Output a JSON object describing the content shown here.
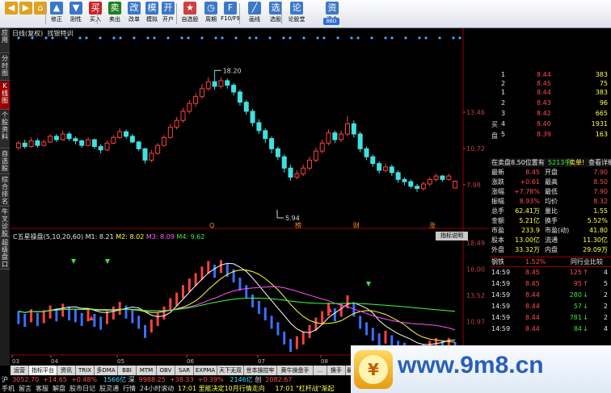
{
  "toolbar": {
    "buttons": [
      {
        "label": "",
        "icon": "back-icon",
        "color": "#e0a020"
      },
      {
        "label": "",
        "icon": "forward-icon",
        "color": "#e0a020"
      },
      {
        "label": "",
        "icon": "home-icon",
        "color": "#e0a020"
      },
      {
        "label": "修正",
        "icon": "up-icon",
        "color": "#3c78c8"
      },
      {
        "label": "刚性",
        "icon": "down-icon",
        "color": "#3c78c8"
      },
      {
        "label": "买入",
        "icon": "buy-icon",
        "color": "#d02020"
      },
      {
        "label": "卖出",
        "icon": "sell-icon",
        "color": "#208020"
      },
      {
        "label": "改单",
        "icon": "edit-icon",
        "color": "#3c78c8"
      },
      {
        "label": "模拟",
        "icon": "simulate-icon",
        "color": "#3c78c8"
      },
      {
        "label": "开户",
        "icon": "account-icon",
        "color": "#3c78c8"
      },
      {
        "label": "自选股",
        "icon": "favorites-icon",
        "color": "#d04040"
      },
      {
        "label": "周期",
        "icon": "period-icon",
        "color": "#3c78c8"
      },
      {
        "label": "F10/F9",
        "icon": "f10-icon",
        "color": "#3c78c8"
      },
      {
        "label": "画线",
        "icon": "draw-icon",
        "color": "#3c78c8"
      },
      {
        "label": "选股",
        "icon": "select-stock-icon",
        "color": "#3c78c8"
      },
      {
        "label": "论股堂",
        "icon": "forum-icon",
        "color": "#3c78c8"
      },
      {
        "label": "资金",
        "icon": "fund-icon",
        "color": "#3c78c8"
      }
    ],
    "bbd": "BBD"
  },
  "sidebar": [
    "应用",
    "分时图",
    "K线图",
    "个股资料",
    "自选股",
    "综合排名",
    "牛叉诊股",
    "超级盘口"
  ],
  "chart_header": {
    "title": "日线(复权)",
    "subtitle": "找银特训"
  },
  "price_axis": [
    "13.46",
    "10.72",
    "7.98"
  ],
  "price_markers": {
    "high": "18.20",
    "low": "5.94"
  },
  "event_markers": [
    "Q",
    "榜",
    "财",
    "涨"
  ],
  "indicator": {
    "name": "C五星操盘(5,10,20,60)",
    "m1": "M1: 8.21",
    "m2": "M2: 8.02",
    "m3": "M3: 8.09",
    "m4": "M4: 9.62",
    "help": "指标说明",
    "axis": [
      "18.49",
      "16.00",
      "13.52",
      "10.97",
      "8.49"
    ]
  },
  "date_axis": [
    "03",
    "04",
    "05",
    "06",
    "07",
    "08"
  ],
  "order_book": {
    "sells": [
      {
        "level": "1",
        "price": "8.44",
        "vol": "383"
      },
      {
        "level": "2",
        "price": "8.45",
        "vol": "75"
      }
    ],
    "side_label": "买盘",
    "buys": [
      {
        "level": "1",
        "price": "8.44",
        "vol": "383"
      },
      {
        "level": "2",
        "price": "8.43",
        "vol": "96"
      },
      {
        "level": "3",
        "price": "8.42",
        "vol": "665"
      },
      {
        "level": "4",
        "price": "8.40",
        "vol": "1931"
      },
      {
        "level": "5",
        "price": "8.39",
        "vol": "163"
      }
    ],
    "notice": "在卖盘8.50位置有",
    "notice_vol": "5213手",
    "notice_tag": "卖单!",
    "notice_link": "查看详细"
  },
  "quote": [
    {
      "l": "最新",
      "v": "8.45",
      "l2": "开盘",
      "v2": "7.90"
    },
    {
      "l": "涨跌",
      "v": "+0.61",
      "l2": "最高",
      "v2": "8.50"
    },
    {
      "l": "涨幅",
      "v": "+7.78%",
      "l2": "最低",
      "v2": "7.90"
    },
    {
      "l": "振幅",
      "v": "8.93%",
      "l2": "均价",
      "v2": "8.32"
    },
    {
      "l": "总手",
      "v": "62.41万",
      "l2": "量比",
      "v2": "1.55"
    },
    {
      "l": "金额",
      "v": "5.21亿",
      "l2": "换手",
      "v2": "5.52%"
    },
    {
      "l": "市盈",
      "v": "233.9",
      "l2": "市盈(动)",
      "v2": "41.80"
    },
    {
      "l": "股本",
      "v": "13.00亿",
      "l2": "流通",
      "v2": "11.30亿"
    },
    {
      "l": "外盘",
      "v": "33.32万",
      "l2": "内盘",
      "v2": "29.09万"
    }
  ],
  "industry": {
    "name": "钢铁",
    "pct": "1.52%",
    "link": "同行业比较"
  },
  "ticks": [
    {
      "t": "14:59",
      "p": "8.45",
      "v": "125",
      "d": "4"
    },
    {
      "t": "14:59",
      "p": "8.45",
      "v": "95",
      "d": "5"
    },
    {
      "t": "14:59",
      "p": "8.44",
      "v": "280",
      "d": "2"
    },
    {
      "t": "14:59",
      "p": "8.44",
      "v": "57",
      "d": "2"
    },
    {
      "t": "14:59",
      "p": "8.44",
      "v": "781",
      "d": "2"
    },
    {
      "t": "14:59",
      "p": "8.44",
      "v": "84",
      "d": "4"
    }
  ],
  "tabs": [
    "运营",
    "指标平台",
    "资讯",
    "TRIX",
    "多DMA",
    "BBI",
    "MTM",
    "OBV",
    "SAR",
    "EXPMA",
    "天下无双",
    "世本操控牢笼",
    "黄牛操盘手",
    "...",
    "换手",
    "最牛精选"
  ],
  "status_bar": {
    "sh_label": "沪",
    "sh_index": "3052.70",
    "sh_chg": "+14.65",
    "sh_pct": "+0.48%",
    "sh_amt": "1566亿",
    "sz_label": "深",
    "sz_index": "9988.25",
    "sz_chg": "+38.33",
    "sz_pct": "+0.39%",
    "sz_amt": "2146亿",
    "cy_label": "创",
    "cy_index": "2082.67",
    "menu": [
      "手机",
      "留言",
      "客服",
      "解盘",
      "股市日记",
      "股灵通",
      "行情",
      "24小时滚动"
    ],
    "news1": "17:01 里能决定10月行情走向",
    "news2": "17:01 \"杠杆战\"渐起"
  },
  "banner": {
    "url": "www.9m8.cn",
    "small": "www.9m8.cn"
  },
  "chart_data": {
    "type": "candlestick",
    "price_ylim": [
      5.0,
      19.5
    ],
    "candles": [
      [
        11.4,
        11.8,
        11.2,
        12.0
      ],
      [
        11.8,
        11.5,
        11.3,
        12.1
      ],
      [
        11.5,
        12.0,
        11.4,
        12.3
      ],
      [
        12.0,
        11.6,
        11.4,
        12.2
      ],
      [
        11.6,
        11.9,
        11.5,
        12.1
      ],
      [
        11.9,
        12.4,
        11.8,
        12.6
      ],
      [
        12.4,
        12.1,
        11.9,
        12.6
      ],
      [
        12.1,
        12.6,
        12.0,
        12.9
      ],
      [
        12.6,
        12.2,
        12.0,
        12.8
      ],
      [
        12.2,
        12.0,
        11.7,
        12.4
      ],
      [
        12.0,
        11.6,
        11.4,
        12.1
      ],
      [
        11.6,
        12.1,
        11.5,
        12.3
      ],
      [
        12.1,
        11.5,
        11.3,
        12.2
      ],
      [
        11.5,
        11.2,
        10.9,
        11.7
      ],
      [
        11.2,
        11.8,
        11.1,
        12.0
      ],
      [
        11.8,
        12.3,
        11.7,
        12.5
      ],
      [
        12.3,
        12.8,
        12.2,
        13.1
      ],
      [
        12.8,
        12.4,
        12.2,
        13.0
      ],
      [
        12.4,
        11.9,
        11.8,
        12.6
      ],
      [
        11.9,
        11.3,
        11.1,
        12.0
      ],
      [
        11.3,
        10.3,
        10.0,
        11.4
      ],
      [
        10.3,
        10.9,
        10.1,
        11.2
      ],
      [
        10.9,
        11.6,
        10.8,
        11.8
      ],
      [
        11.6,
        12.3,
        11.5,
        12.5
      ],
      [
        12.3,
        13.2,
        12.2,
        13.5
      ],
      [
        13.2,
        13.8,
        13.0,
        14.1
      ],
      [
        13.8,
        14.6,
        13.6,
        14.9
      ],
      [
        14.6,
        15.3,
        14.4,
        15.6
      ],
      [
        15.3,
        15.9,
        15.0,
        16.2
      ],
      [
        15.9,
        16.6,
        15.7,
        17.0
      ],
      [
        16.6,
        17.2,
        16.4,
        17.6
      ],
      [
        17.2,
        16.8,
        16.5,
        18.2
      ],
      [
        16.8,
        17.3,
        16.6,
        17.6
      ],
      [
        17.3,
        16.9,
        16.6,
        17.5
      ],
      [
        16.9,
        16.3,
        16.0,
        17.1
      ],
      [
        16.3,
        15.4,
        15.1,
        16.5
      ],
      [
        15.4,
        14.6,
        14.3,
        15.6
      ],
      [
        14.6,
        13.6,
        13.3,
        14.8
      ],
      [
        13.6,
        12.9,
        12.6,
        13.9
      ],
      [
        12.9,
        12.2,
        11.8,
        13.1
      ],
      [
        12.2,
        11.3,
        10.9,
        12.4
      ],
      [
        11.3,
        10.6,
        10.3,
        11.5
      ],
      [
        10.6,
        9.6,
        9.2,
        10.8
      ],
      [
        9.6,
        8.8,
        8.5,
        9.9
      ],
      [
        8.8,
        9.1,
        8.6,
        9.4
      ],
      [
        9.1,
        9.6,
        8.9,
        9.9
      ],
      [
        9.6,
        10.3,
        9.4,
        10.6
      ],
      [
        10.3,
        11.1,
        10.1,
        11.4
      ],
      [
        11.1,
        11.8,
        10.9,
        12.1
      ],
      [
        11.8,
        12.7,
        11.6,
        13.0
      ],
      [
        12.7,
        12.1,
        11.8,
        12.9
      ],
      [
        12.1,
        12.6,
        11.9,
        12.9
      ],
      [
        12.6,
        13.5,
        12.4,
        14.2
      ],
      [
        13.5,
        12.6,
        12.3,
        13.8
      ],
      [
        12.6,
        11.3,
        11.0,
        12.8
      ],
      [
        11.3,
        10.6,
        10.3,
        11.5
      ],
      [
        10.6,
        10.0,
        9.7,
        10.8
      ],
      [
        10.0,
        9.4,
        9.1,
        10.2
      ],
      [
        9.4,
        9.7,
        9.2,
        10.0
      ],
      [
        9.7,
        9.2,
        8.9,
        9.9
      ],
      [
        9.2,
        8.6,
        8.3,
        9.4
      ],
      [
        8.6,
        8.4,
        8.1,
        8.8
      ],
      [
        8.4,
        8.0,
        7.8,
        8.6
      ],
      [
        8.0,
        7.8,
        7.5,
        8.2
      ],
      [
        7.8,
        8.2,
        7.6,
        8.4
      ],
      [
        8.2,
        8.6,
        8.0,
        8.8
      ],
      [
        8.6,
        8.9,
        8.4,
        9.1
      ],
      [
        8.9,
        8.6,
        8.4,
        9.0
      ],
      [
        8.6,
        8.9,
        8.5,
        9.1
      ],
      [
        7.84,
        8.45,
        7.9,
        8.5
      ]
    ],
    "ma_lines": [
      {
        "name": "M1",
        "color": "#ffffff"
      },
      {
        "name": "M2",
        "color": "#ffff40"
      },
      {
        "name": "M3",
        "color": "#ff50ff"
      },
      {
        "name": "M4",
        "color": "#40ff40"
      }
    ],
    "indicator_ylim": [
      7.5,
      19.5
    ]
  }
}
